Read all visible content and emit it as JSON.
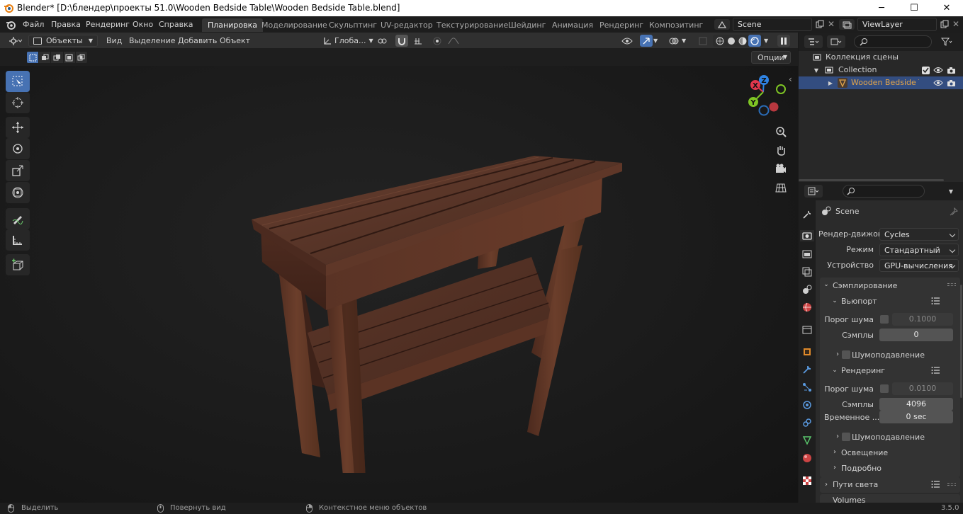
{
  "window": {
    "title": "Blender* [D:\\блендер\\проекты 51.0\\Wooden Bedside Table\\Wooden Bedside Table.blend]",
    "controls": {
      "minimize": "─",
      "maximize": "☐",
      "close": "✕"
    }
  },
  "menu": [
    "Файл",
    "Правка",
    "Рендеринг",
    "Окно",
    "Справка"
  ],
  "workspaces": [
    {
      "label": "Планировка",
      "active": true
    },
    {
      "label": "Моделирование",
      "active": false
    },
    {
      "label": "Скульптинг",
      "active": false
    },
    {
      "label": "UV-редактор",
      "active": false
    },
    {
      "label": "Текстурирование",
      "active": false
    },
    {
      "label": "Шейдинг",
      "active": false
    },
    {
      "label": "Анимация",
      "active": false
    },
    {
      "label": "Рендеринг",
      "active": false
    },
    {
      "label": "Композитинг",
      "active": false
    }
  ],
  "scene": {
    "name": "Scene"
  },
  "view_layer": {
    "name": "ViewLayer"
  },
  "viewport_header": {
    "mode": "Объекты",
    "menus": [
      "Вид",
      "Выделение",
      "Добавить",
      "Объект"
    ],
    "transform_orientation": "Глоба...",
    "options": "Опции"
  },
  "outliner": {
    "root": "Коллекция сцены",
    "collection": "Collection",
    "object": "Wooden Bedside Tab"
  },
  "properties": {
    "context": "Scene",
    "render_engine": {
      "label": "Рендер-движок",
      "value": "Cycles"
    },
    "mode": {
      "label": "Режим",
      "value": "Стандартный"
    },
    "device": {
      "label": "Устройство",
      "value": "GPU-вычисления"
    },
    "sampling": {
      "title": "Сэмплирование",
      "viewport": {
        "title": "Вьюпорт",
        "noise_threshold_label": "Порог шума",
        "noise_threshold": "0.1000",
        "samples_label": "Сэмплы",
        "samples": "0",
        "denoise": "Шумоподавление"
      },
      "render": {
        "title": "Рендеринг",
        "noise_threshold_label": "Порог шума",
        "noise_threshold": "0.0100",
        "samples_label": "Сэмплы",
        "samples": "4096",
        "time_label": "Временное ...",
        "time": "0 sec",
        "denoise": "Шумоподавление"
      },
      "lights": "Освещение",
      "advanced": "Подробно"
    },
    "light_paths": "Пути света",
    "volumes": "Volumes"
  },
  "statusbar": {
    "select": "Выделить",
    "rotate": "Повернуть вид",
    "context_menu": "Контекстное меню объектов",
    "version": "3.5.0"
  },
  "gizmo": {
    "x": "X",
    "y": "Y",
    "z": "Z"
  },
  "colors": {
    "accent": "#4772b3",
    "selected_row": "#334d80",
    "object_name": "#e2a54b",
    "gizmo_x": "#e3374d",
    "gizmo_y": "#7ec524",
    "gizmo_z": "#2f83e3"
  }
}
